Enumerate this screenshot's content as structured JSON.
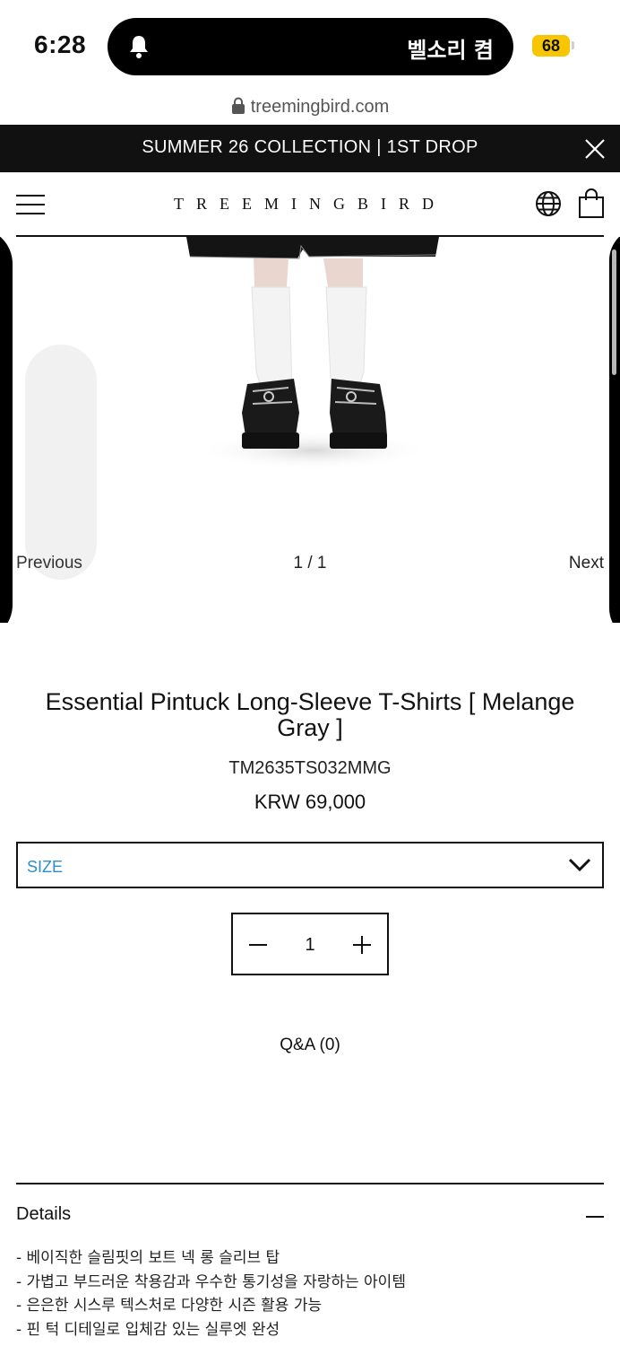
{
  "status": {
    "time": "6:28",
    "island_text": "벨소리 켬",
    "battery": "68"
  },
  "browser": {
    "url": "treemingbird.com"
  },
  "announcement": {
    "text": "SUMMER 26 COLLECTION | 1ST DROP"
  },
  "header": {
    "logo": "TREEMINGBIRD"
  },
  "gallery": {
    "prev_label": "Previous",
    "pager": "1 / 1",
    "next_label": "Next"
  },
  "product": {
    "title": "Essential Pintuck Long-Sleeve T-Shirts [ Melange Gray ]",
    "sku": "TM2635TS032MMG",
    "price": "KRW 69,000",
    "size_label": "SIZE",
    "quantity": "1",
    "qna": "Q&A (0)"
  },
  "details": {
    "title": "Details",
    "items": [
      "- 베이직한 슬림핏의 보트 넥 롱 슬리브 탑",
      "- 가볍고 부드러운 착용감과 우수한 통기성을 자랑하는 아이템",
      "- 은은한 시스루 텍스처로 다양한 시즌 활용 가능",
      "- 핀 턱 디테일로 입체감 있는 실루엣 완성"
    ]
  },
  "colors": {
    "accent_blue": "#2c8fc7",
    "battery_yellow": "#f7c600",
    "black": "#111111"
  }
}
